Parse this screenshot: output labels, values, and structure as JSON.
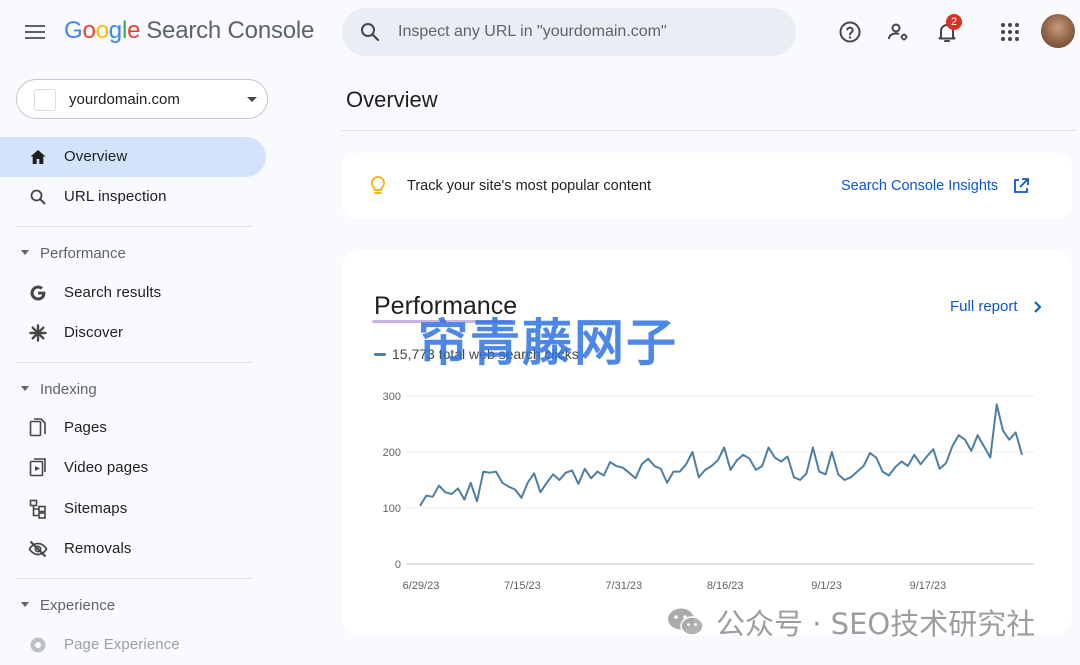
{
  "header": {
    "logo_letters": [
      "G",
      "o",
      "o",
      "g",
      "l",
      "e"
    ],
    "product": "Search Console",
    "search_placeholder": "Inspect any URL in \"yourdomain.com\"",
    "notification_count": "2",
    "icons": [
      "menu-icon",
      "search-icon",
      "help-icon",
      "manage-users-icon",
      "notifications-icon",
      "apps-icon"
    ]
  },
  "sidebar": {
    "property": "yourdomain.com",
    "top_items": [
      {
        "label": "Overview",
        "icon": "home-icon",
        "active": true
      },
      {
        "label": "URL inspection",
        "icon": "search-icon"
      }
    ],
    "sections": [
      {
        "title": "Performance",
        "items": [
          {
            "label": "Search results",
            "icon": "google-g-icon"
          },
          {
            "label": "Discover",
            "icon": "asterisk-icon"
          }
        ]
      },
      {
        "title": "Indexing",
        "items": [
          {
            "label": "Pages",
            "icon": "pages-icon"
          },
          {
            "label": "Video pages",
            "icon": "video-pages-icon"
          },
          {
            "label": "Sitemaps",
            "icon": "sitemap-icon"
          },
          {
            "label": "Removals",
            "icon": "visibility-off-icon"
          }
        ]
      },
      {
        "title": "Experience",
        "items": [
          {
            "label": "Page Experience",
            "icon": "page-experience-icon"
          }
        ]
      }
    ]
  },
  "main": {
    "title": "Overview",
    "insight": {
      "text": "Track your site's most popular content",
      "link": "Search Console Insights"
    },
    "performance": {
      "title": "Performance",
      "full_report": "Full report",
      "legend": "15,773 total web search clicks"
    }
  },
  "chart_data": {
    "type": "line",
    "title": "Performance",
    "xlabel": "",
    "ylabel": "",
    "ylim": [
      0,
      300
    ],
    "yticks": [
      "0",
      "100",
      "200",
      "300"
    ],
    "xticks": [
      "6/29/23",
      "7/15/23",
      "7/31/23",
      "8/16/23",
      "9/1/23",
      "9/17/23"
    ],
    "grid": true,
    "series": [
      {
        "name": "15,773 total web search clicks",
        "color": "#4e7fa3",
        "values": [
          104,
          122,
          120,
          140,
          128,
          125,
          135,
          115,
          145,
          112,
          165,
          163,
          165,
          145,
          138,
          133,
          118,
          145,
          162,
          128,
          145,
          160,
          150,
          163,
          167,
          143,
          170,
          153,
          165,
          158,
          182,
          175,
          172,
          163,
          153,
          178,
          188,
          175,
          170,
          145,
          165,
          165,
          178,
          200,
          155,
          168,
          175,
          185,
          208,
          168,
          185,
          195,
          188,
          168,
          175,
          208,
          190,
          183,
          192,
          155,
          150,
          162,
          208,
          165,
          160,
          200,
          160,
          150,
          155,
          165,
          175,
          198,
          190,
          165,
          158,
          173,
          183,
          175,
          195,
          178,
          192,
          205,
          170,
          180,
          210,
          230,
          222,
          202,
          230,
          210,
          190,
          285,
          238,
          222,
          235,
          195
        ]
      }
    ]
  },
  "watermarks": {
    "overlay": "帘青藤网子",
    "footer": "公众号 · SEO技术研究社"
  }
}
